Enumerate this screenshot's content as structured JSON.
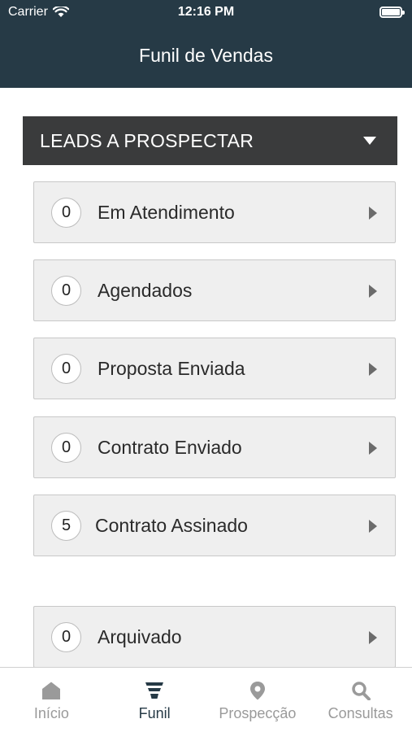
{
  "status_bar": {
    "carrier": "Carrier",
    "time": "12:16 PM",
    "wifi_icon": "wifi-icon",
    "battery_icon": "battery-icon"
  },
  "header": {
    "title": "Funil de Vendas"
  },
  "section": {
    "title": "LEADS A PROSPECTAR",
    "icon": "caret-down-icon"
  },
  "stages": [
    {
      "count": "0",
      "label": "Em Atendimento"
    },
    {
      "count": "0",
      "label": "Agendados"
    },
    {
      "count": "0",
      "label": "Proposta Enviada"
    },
    {
      "count": "0",
      "label": "Contrato Enviado"
    },
    {
      "count": "5",
      "label": "Contrato Assinado"
    }
  ],
  "archived": {
    "count": "0",
    "label": "Arquivado"
  },
  "tabbar": {
    "items": [
      {
        "label": "Início",
        "icon": "home-icon",
        "active": false
      },
      {
        "label": "Funil",
        "icon": "funnel-icon",
        "active": true
      },
      {
        "label": "Prospecção",
        "icon": "map-pin-icon",
        "active": false
      },
      {
        "label": "Consultas",
        "icon": "search-icon",
        "active": false
      }
    ]
  },
  "colors": {
    "header_bg": "#263a46",
    "section_bg": "#3a3b3c",
    "row_bg": "#efefef",
    "tab_active": "#263a46",
    "tab_inactive": "#9a9a9a"
  }
}
